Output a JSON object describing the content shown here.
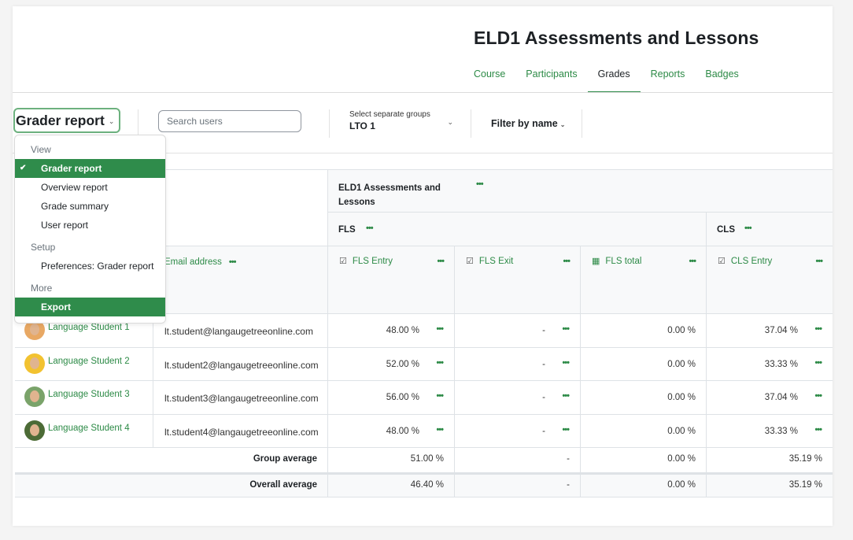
{
  "header": {
    "course_title": "ELD1 Assessments and Lessons",
    "nav": [
      {
        "label": "Course",
        "active": false
      },
      {
        "label": "Participants",
        "active": false
      },
      {
        "label": "Grades",
        "active": true
      },
      {
        "label": "Reports",
        "active": false
      },
      {
        "label": "Badges",
        "active": false
      }
    ]
  },
  "toolbar": {
    "report_selector_label": "Grader report",
    "search_placeholder": "Search users",
    "groups_label": "Select separate groups",
    "groups_value": "LTO 1",
    "filter_label": "Filter by name"
  },
  "dropdown": {
    "sections": [
      {
        "heading": "View",
        "items": [
          {
            "label": "Grader report",
            "selected": true,
            "checked": true
          },
          {
            "label": "Overview report"
          },
          {
            "label": "Grade summary"
          },
          {
            "label": "User report"
          }
        ]
      },
      {
        "heading": "Setup",
        "items": [
          {
            "label": "Preferences: Grader report"
          }
        ]
      },
      {
        "heading": "More",
        "items": [
          {
            "label": "Export",
            "selected": true
          }
        ]
      }
    ]
  },
  "grid": {
    "category": "ELD1 Assessments and Lessons",
    "subcategories": [
      "FLS",
      "CLS"
    ],
    "email_header": "Email address",
    "columns": [
      {
        "label": "FLS Entry",
        "icon": "assignment-icon"
      },
      {
        "label": "FLS Exit",
        "icon": "assignment-icon"
      },
      {
        "label": "FLS total",
        "icon": "calculator-icon"
      },
      {
        "label": "CLS Entry",
        "icon": "assignment-icon"
      }
    ],
    "students": [
      {
        "name": "Language Student 1",
        "email": "lt.student@langaugetreeonline.com",
        "grades": [
          "48.00 %",
          "-",
          "0.00 %",
          "37.04 %"
        ],
        "avatar_color": "#e8a864"
      },
      {
        "name": "Language Student 2",
        "email": "lt.student2@langaugetreeonline.com",
        "grades": [
          "52.00 %",
          "-",
          "0.00 %",
          "33.33 %"
        ],
        "avatar_color": "#f2c230"
      },
      {
        "name": "Language Student 3",
        "email": "lt.student3@langaugetreeonline.com",
        "grades": [
          "56.00 %",
          "-",
          "0.00 %",
          "37.04 %"
        ],
        "avatar_color": "#7aa36a"
      },
      {
        "name": "Language Student 4",
        "email": "lt.student4@langaugetreeonline.com",
        "grades": [
          "48.00 %",
          "-",
          "0.00 %",
          "33.33 %"
        ],
        "avatar_color": "#4c6b36"
      }
    ],
    "averages": [
      {
        "label": "Group average",
        "values": [
          "51.00 %",
          "-",
          "0.00 %",
          "35.19 %"
        ]
      },
      {
        "label": "Overall average",
        "values": [
          "46.40 %",
          "-",
          "0.00 %",
          "35.19 %"
        ]
      }
    ]
  },
  "colors": {
    "accent": "#2f8c4b",
    "link": "#2c8a46"
  }
}
